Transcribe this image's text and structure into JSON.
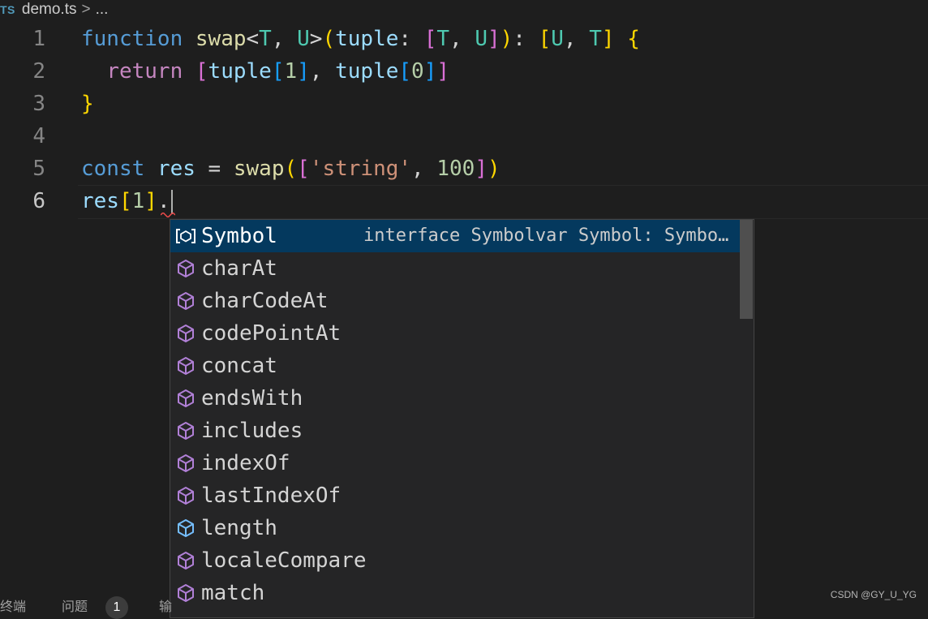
{
  "breadcrumb": {
    "file_icon_text": "TS",
    "file_name": "demo.ts",
    "separator": ">",
    "trail": "..."
  },
  "editor": {
    "lines": [
      {
        "number": "1",
        "tokens": [
          {
            "text": "function",
            "kind": "keyword"
          },
          {
            "text": " ",
            "kind": "plain"
          },
          {
            "text": "swap",
            "kind": "function"
          },
          {
            "text": "<",
            "kind": "plain"
          },
          {
            "text": "T",
            "kind": "type"
          },
          {
            "text": ", ",
            "kind": "plain"
          },
          {
            "text": "U",
            "kind": "type"
          },
          {
            "text": ">",
            "kind": "plain"
          },
          {
            "text": "(",
            "kind": "bracket1"
          },
          {
            "text": "tuple",
            "kind": "variable"
          },
          {
            "text": ": ",
            "kind": "plain"
          },
          {
            "text": "[",
            "kind": "bracket2"
          },
          {
            "text": "T",
            "kind": "type"
          },
          {
            "text": ", ",
            "kind": "plain"
          },
          {
            "text": "U",
            "kind": "type"
          },
          {
            "text": "]",
            "kind": "bracket2"
          },
          {
            "text": ")",
            "kind": "bracket1"
          },
          {
            "text": ": ",
            "kind": "plain"
          },
          {
            "text": "[",
            "kind": "bracket1"
          },
          {
            "text": "U",
            "kind": "type"
          },
          {
            "text": ", ",
            "kind": "plain"
          },
          {
            "text": "T",
            "kind": "type"
          },
          {
            "text": "]",
            "kind": "bracket1"
          },
          {
            "text": " ",
            "kind": "plain"
          },
          {
            "text": "{",
            "kind": "bracket1"
          }
        ]
      },
      {
        "number": "2",
        "tokens": [
          {
            "text": "  ",
            "kind": "plain"
          },
          {
            "text": "return",
            "kind": "control"
          },
          {
            "text": " ",
            "kind": "plain"
          },
          {
            "text": "[",
            "kind": "bracket2"
          },
          {
            "text": "tuple",
            "kind": "variable"
          },
          {
            "text": "[",
            "kind": "bracket3"
          },
          {
            "text": "1",
            "kind": "number"
          },
          {
            "text": "]",
            "kind": "bracket3"
          },
          {
            "text": ", ",
            "kind": "plain"
          },
          {
            "text": "tuple",
            "kind": "variable"
          },
          {
            "text": "[",
            "kind": "bracket3"
          },
          {
            "text": "0",
            "kind": "number"
          },
          {
            "text": "]",
            "kind": "bracket3"
          },
          {
            "text": "]",
            "kind": "bracket2"
          }
        ]
      },
      {
        "number": "3",
        "tokens": [
          {
            "text": "}",
            "kind": "bracket1"
          }
        ]
      },
      {
        "number": "4",
        "tokens": []
      },
      {
        "number": "5",
        "tokens": [
          {
            "text": "const",
            "kind": "keyword"
          },
          {
            "text": " ",
            "kind": "plain"
          },
          {
            "text": "res",
            "kind": "variable"
          },
          {
            "text": " = ",
            "kind": "plain"
          },
          {
            "text": "swap",
            "kind": "function"
          },
          {
            "text": "(",
            "kind": "bracket1"
          },
          {
            "text": "[",
            "kind": "bracket2"
          },
          {
            "text": "'string'",
            "kind": "string"
          },
          {
            "text": ", ",
            "kind": "plain"
          },
          {
            "text": "100",
            "kind": "number"
          },
          {
            "text": "]",
            "kind": "bracket2"
          },
          {
            "text": ")",
            "kind": "bracket1"
          }
        ]
      },
      {
        "number": "6",
        "active": true,
        "tokens": [
          {
            "text": "res",
            "kind": "variable"
          },
          {
            "text": "[",
            "kind": "bracket1"
          },
          {
            "text": "1",
            "kind": "number"
          },
          {
            "text": "]",
            "kind": "bracket1"
          },
          {
            "text": ".",
            "kind": "plain"
          }
        ]
      }
    ]
  },
  "suggest": {
    "selected_index": 0,
    "selected_detail": "interface Symbolvar Symbol: SymbolConstructor",
    "items": [
      {
        "label": "Symbol",
        "icon": "interface-icon"
      },
      {
        "label": "charAt",
        "icon": "method-icon"
      },
      {
        "label": "charCodeAt",
        "icon": "method-icon"
      },
      {
        "label": "codePointAt",
        "icon": "method-icon"
      },
      {
        "label": "concat",
        "icon": "method-icon"
      },
      {
        "label": "endsWith",
        "icon": "method-icon"
      },
      {
        "label": "includes",
        "icon": "method-icon"
      },
      {
        "label": "indexOf",
        "icon": "method-icon"
      },
      {
        "label": "lastIndexOf",
        "icon": "method-icon"
      },
      {
        "label": "length",
        "icon": "property-icon"
      },
      {
        "label": "localeCompare",
        "icon": "method-icon"
      },
      {
        "label": "match",
        "icon": "method-icon"
      }
    ]
  },
  "panel": {
    "tab_terminal": "终端",
    "tab_problems": "问题",
    "problems_count": "1",
    "tab_next": "输"
  },
  "watermark": "CSDN @GY_U_YG",
  "colors": {
    "keyword": "#569cd6",
    "control": "#c586c0",
    "function": "#dcdcaa",
    "variable": "#9cdcfe",
    "type": "#4ec9b0",
    "number": "#b5cea8",
    "string": "#ce9178",
    "selection_bg": "#04395e",
    "method_icon": "#b180d7",
    "property_icon": "#75beff"
  }
}
